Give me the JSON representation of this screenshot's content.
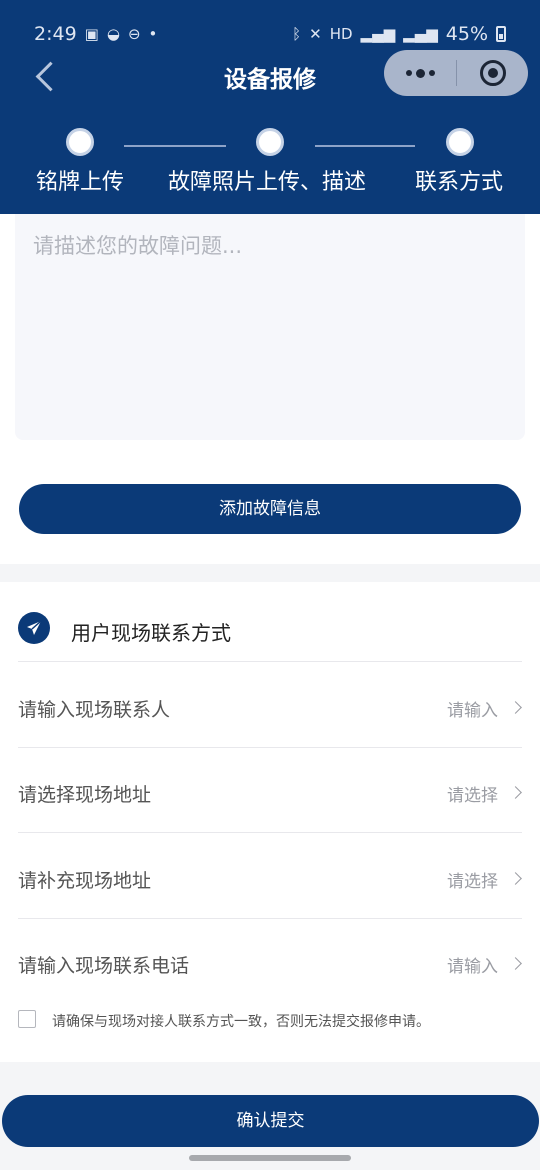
{
  "status_bar": {
    "time": "2:49",
    "battery": "45%"
  },
  "nav": {
    "title": "设备报修"
  },
  "steps": [
    {
      "label": "铭牌上传"
    },
    {
      "label": "故障照片上传、描述"
    },
    {
      "label": "联系方式"
    }
  ],
  "description": {
    "placeholder": "请描述您的故障问题...",
    "value": ""
  },
  "add_fault_button": "添加故障信息",
  "contact_section": {
    "title": "用户现场联系方式",
    "rows": [
      {
        "label": "请输入现场联系人",
        "hint": "请输入"
      },
      {
        "label": "请选择现场地址",
        "hint": "请选择"
      },
      {
        "label": "请补充现场地址",
        "hint": "请选择"
      },
      {
        "label": "请输入现场联系电话",
        "hint": "请输入"
      }
    ],
    "agreement": "请确保与现场对接人联系方式一致，否则无法提交报修申请。"
  },
  "submit_button": "确认提交",
  "colors": {
    "primary": "#0b3a78",
    "background": "#f4f5f7"
  }
}
